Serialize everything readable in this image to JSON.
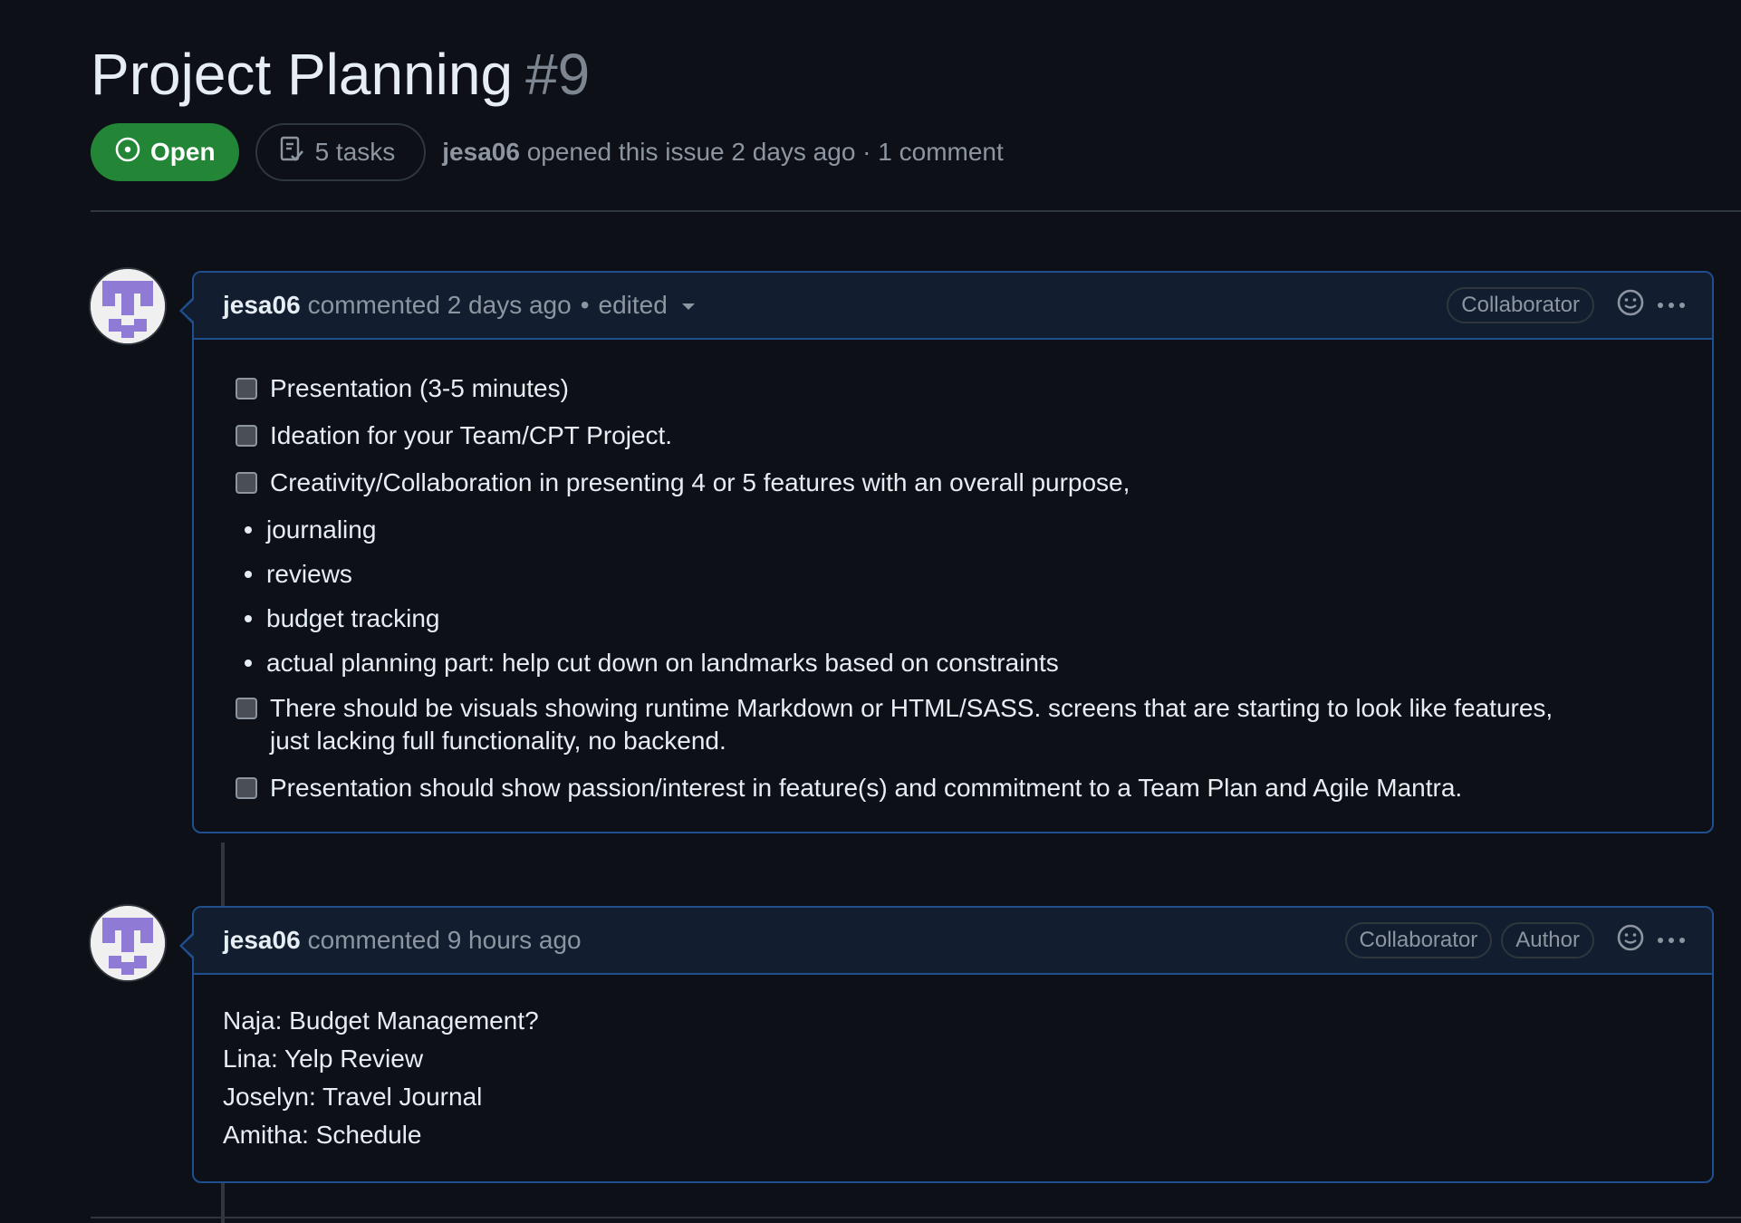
{
  "issue": {
    "title": "Project Planning",
    "number": "#9",
    "state_label": "Open",
    "tasks_label": "5 tasks",
    "author": "jesa06",
    "opened_text": "opened this issue 2 days ago · 1 comment"
  },
  "comments": [
    {
      "author": "jesa06",
      "meta": "commented 2 days ago",
      "edited_label": "edited",
      "labels": [
        "Collaborator"
      ],
      "tasks_top": [
        "Presentation (3-5 minutes)",
        "Ideation for your Team/CPT Project.",
        "Creativity/Collaboration in presenting 4 or 5 features with an overall purpose,"
      ],
      "bullets": [
        "journaling",
        "reviews",
        "budget tracking",
        "actual planning part: help cut down on landmarks based on constraints"
      ],
      "tasks_bottom": [
        "There should be visuals showing runtime Markdown or HTML/SASS. screens that are starting to look like features, just lacking full functionality, no backend.",
        "Presentation should show passion/interest in feature(s) and commitment to a Team Plan and Agile Mantra."
      ]
    },
    {
      "author": "jesa06",
      "meta": "commented 9 hours ago",
      "labels": [
        "Collaborator",
        "Author"
      ],
      "lines": [
        "Naja: Budget Management?",
        "Lina: Yelp Review",
        "Joselyn: Travel Journal",
        "Amitha: Schedule"
      ]
    }
  ],
  "icons": {
    "status": "issue-opened-icon",
    "tasks": "checklist-icon",
    "reaction": "smiley-icon",
    "more": "kebab-horizontal-icon"
  },
  "colors": {
    "background": "#0d1117",
    "open_green": "#238636",
    "comment_border": "#1f4f8f",
    "comment_header": "#121d2f",
    "muted_text": "#8d96a0",
    "avatar_purple": "#8f7ad6"
  }
}
